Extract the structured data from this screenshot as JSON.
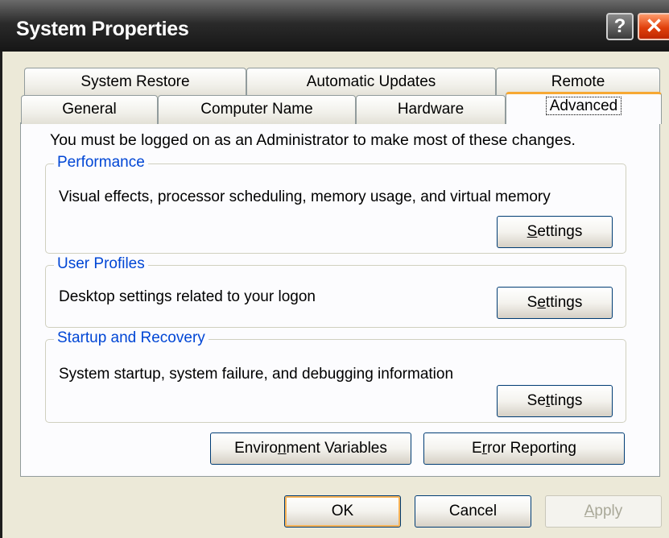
{
  "window": {
    "title": "System Properties",
    "help_glyph": "?",
    "close_glyph": "✕"
  },
  "tabs_back": [
    {
      "label": "System Restore"
    },
    {
      "label": "Automatic Updates"
    },
    {
      "label": "Remote"
    }
  ],
  "tabs_front": [
    {
      "label": "General"
    },
    {
      "label": "Computer Name"
    },
    {
      "label": "Hardware"
    },
    {
      "label": "Advanced",
      "active": true
    }
  ],
  "panel": {
    "notice": "You must be logged on as an Administrator to make most of these changes."
  },
  "groups": {
    "performance": {
      "label": "Performance",
      "description": "Visual effects, processor scheduling, memory usage, and virtual memory",
      "button": {
        "mnemonic": "S",
        "rest": "ettings"
      }
    },
    "user_profiles": {
      "label": "User Profiles",
      "description": "Desktop settings related to your logon",
      "button": {
        "mnemonic": "e",
        "before": "S",
        "rest": "ttings"
      }
    },
    "startup_recovery": {
      "label": "Startup and Recovery",
      "description": "System startup, system failure, and debugging information",
      "button": {
        "mnemonic": "t",
        "before": "Se",
        "rest": "tings"
      }
    }
  },
  "panel_buttons": {
    "env_vars": {
      "before": "Enviro",
      "mnemonic": "n",
      "rest": "ment Variables"
    },
    "error_reporting": {
      "before": "E",
      "mnemonic": "r",
      "rest": "ror Reporting"
    }
  },
  "dialog_buttons": {
    "ok": "OK",
    "cancel": "Cancel",
    "apply": {
      "mnemonic": "A",
      "rest": "pply",
      "enabled": false
    }
  }
}
